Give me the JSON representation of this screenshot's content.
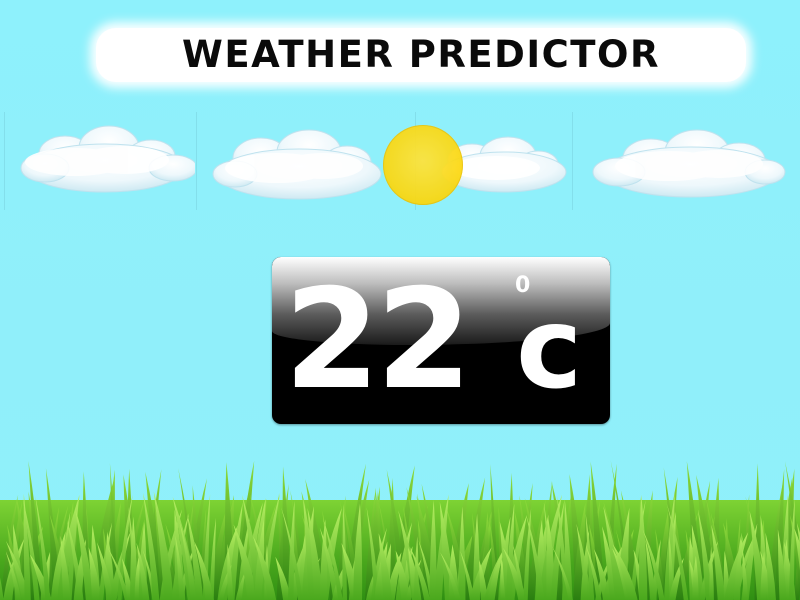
{
  "app": {
    "title": "WEATHER PREDICTOR"
  },
  "sky": {
    "clouds": [
      "cloud-icon",
      "cloud-icon",
      "cloud-icon",
      "cloud-icon"
    ],
    "sun": "sun-icon"
  },
  "temperature": {
    "value": "22",
    "degree_symbol": "0",
    "unit": "c"
  },
  "ground": {
    "icon": "grass-icon"
  },
  "colors": {
    "sky": "#8ff0fb",
    "sun": "#fbd70d",
    "panel": "#000000",
    "grass_light": "#9ee34a",
    "grass_dark": "#2f8f12"
  }
}
